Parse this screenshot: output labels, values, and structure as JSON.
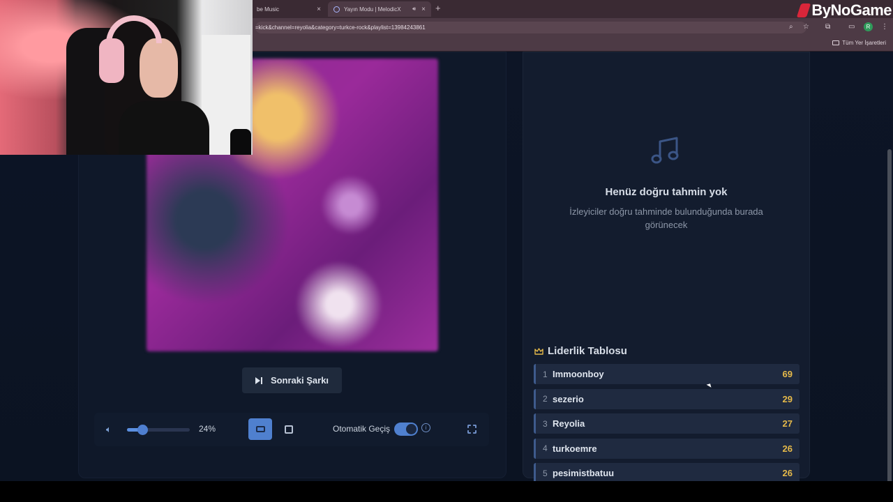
{
  "browser": {
    "tabs": [
      {
        "label": "be Music",
        "active": false
      },
      {
        "label": "Yayın Modu | MelodicX",
        "active": true
      }
    ],
    "address": "=kick&channel=reyolia&category=turkce-rock&playlist=13984243861",
    "bookmarks_label": "Tüm Yer İşaretleri",
    "avatar_letter": "R",
    "close_glyph": "×",
    "newtab_glyph": "+",
    "speaker_glyph": "🔊︎"
  },
  "brand": {
    "name": "ByNoGame"
  },
  "player": {
    "next_button_label": "Sonraki Şarkı",
    "volume_percent": 24,
    "volume_label": "24%",
    "auto_label": "Otomatik Geçiş",
    "auto_enabled": true,
    "info_glyph": "i"
  },
  "guesses": {
    "empty_title": "Henüz doğru tahmin yok",
    "empty_subtitle": "İzleyiciler doğru tahminde bulunduğunda burada görünecek"
  },
  "leaderboard": {
    "title": "Liderlik Tablosu",
    "rows": [
      {
        "rank": "1",
        "name": "Immoonboy",
        "score": "69"
      },
      {
        "rank": "2",
        "name": "sezerio",
        "score": "29"
      },
      {
        "rank": "3",
        "name": "Reyolia",
        "score": "27"
      },
      {
        "rank": "4",
        "name": "turkoemre",
        "score": "26"
      },
      {
        "rank": "5",
        "name": "pesimistbatuu",
        "score": "26"
      }
    ]
  },
  "colors": {
    "accent": "#4f80cf",
    "score": "#e5b94a",
    "brand_mark": "#d9263a"
  }
}
